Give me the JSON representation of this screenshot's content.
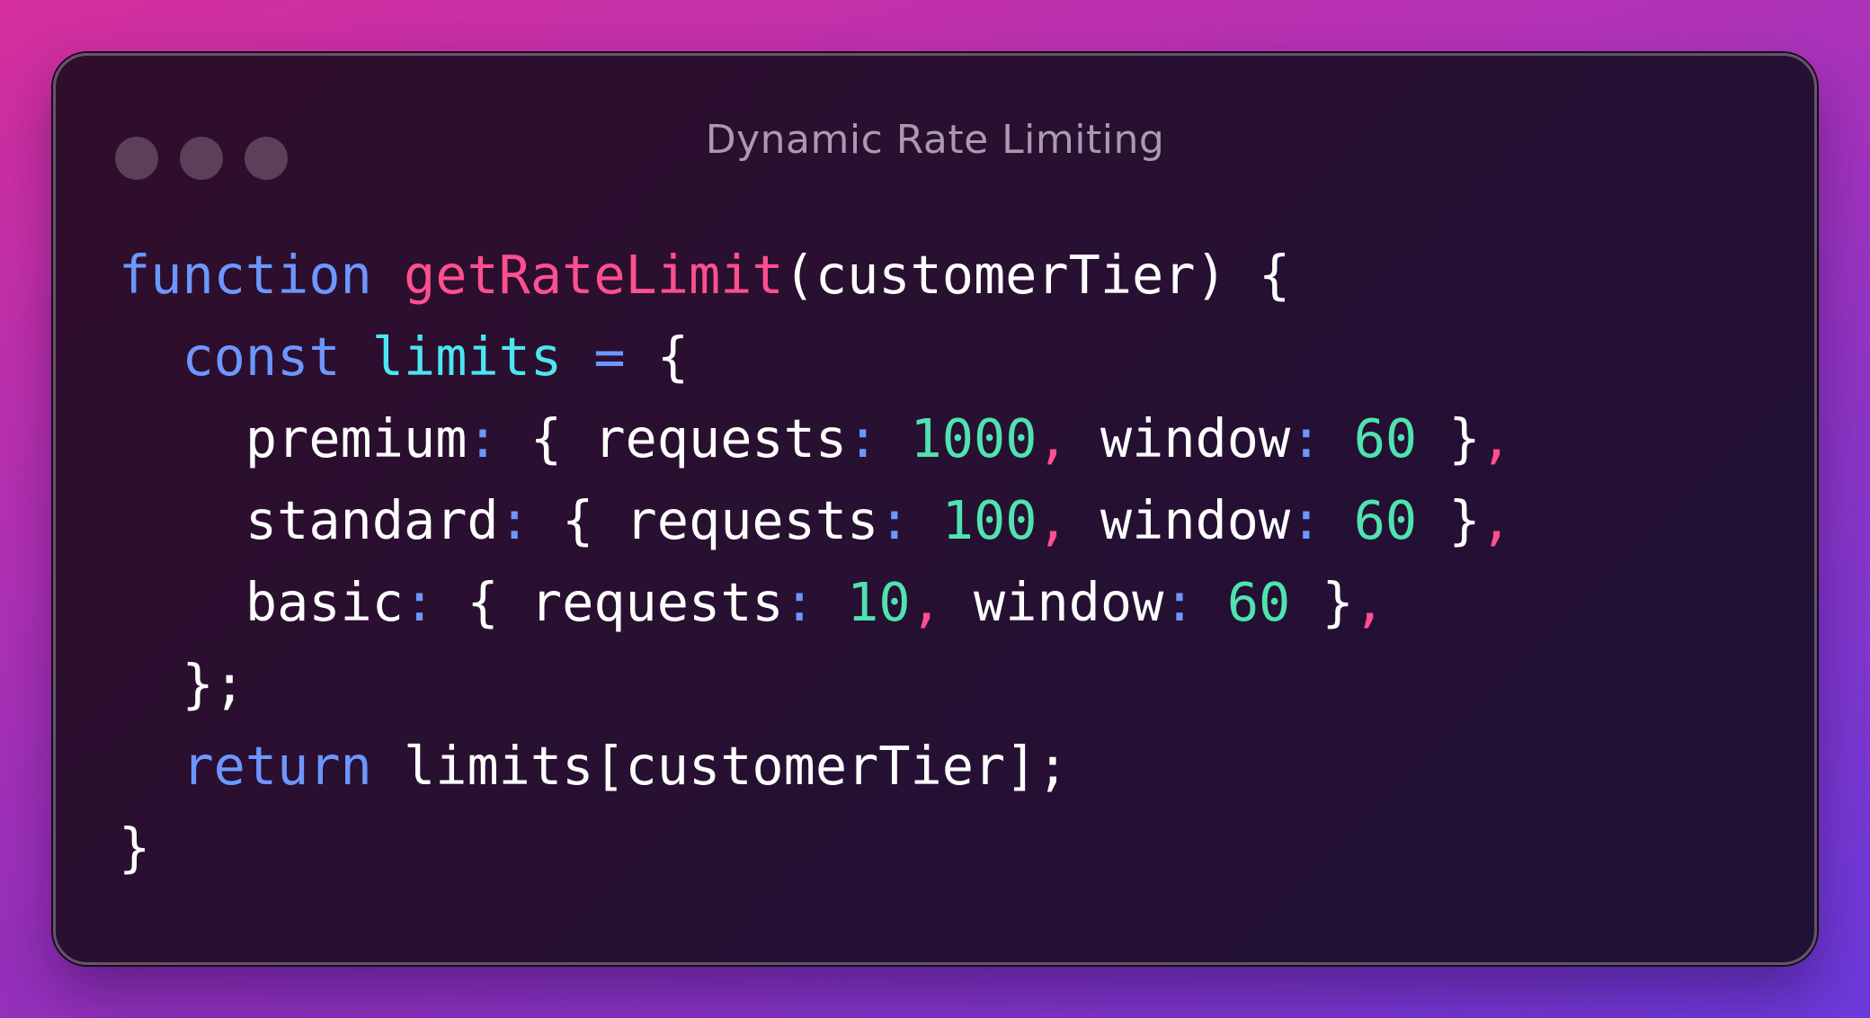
{
  "window": {
    "title": "Dynamic Rate Limiting",
    "controls": [
      "window-dot",
      "window-dot",
      "window-dot"
    ]
  },
  "colors": {
    "keyword": "#6c97ff",
    "function_name": "#ff4f8f",
    "variable": "#4ce6f0",
    "number": "#4fe3b0",
    "plain": "#ffffff",
    "title": "#a99bad"
  },
  "code": {
    "language": "javascript",
    "lines": [
      [
        {
          "t": "function",
          "c": "kw"
        },
        {
          "t": " ",
          "c": "plain"
        },
        {
          "t": "getRateLimit",
          "c": "fn"
        },
        {
          "t": "(customerTier) {",
          "c": "plain"
        }
      ],
      [
        {
          "t": "  ",
          "c": "plain"
        },
        {
          "t": "const",
          "c": "kw"
        },
        {
          "t": " ",
          "c": "plain"
        },
        {
          "t": "limits",
          "c": "var"
        },
        {
          "t": " ",
          "c": "plain"
        },
        {
          "t": "=",
          "c": "pun"
        },
        {
          "t": " {",
          "c": "plain"
        }
      ],
      [
        {
          "t": "    premium",
          "c": "plain"
        },
        {
          "t": ":",
          "c": "pun"
        },
        {
          "t": " { requests",
          "c": "plain"
        },
        {
          "t": ":",
          "c": "pun"
        },
        {
          "t": " ",
          "c": "plain"
        },
        {
          "t": "1000",
          "c": "num"
        },
        {
          "t": ",",
          "c": "cm"
        },
        {
          "t": " window",
          "c": "plain"
        },
        {
          "t": ":",
          "c": "pun"
        },
        {
          "t": " ",
          "c": "plain"
        },
        {
          "t": "60",
          "c": "num"
        },
        {
          "t": " }",
          "c": "plain"
        },
        {
          "t": ",",
          "c": "cm"
        }
      ],
      [
        {
          "t": "    standard",
          "c": "plain"
        },
        {
          "t": ":",
          "c": "pun"
        },
        {
          "t": " { requests",
          "c": "plain"
        },
        {
          "t": ":",
          "c": "pun"
        },
        {
          "t": " ",
          "c": "plain"
        },
        {
          "t": "100",
          "c": "num"
        },
        {
          "t": ",",
          "c": "cm"
        },
        {
          "t": " window",
          "c": "plain"
        },
        {
          "t": ":",
          "c": "pun"
        },
        {
          "t": " ",
          "c": "plain"
        },
        {
          "t": "60",
          "c": "num"
        },
        {
          "t": " }",
          "c": "plain"
        },
        {
          "t": ",",
          "c": "cm"
        }
      ],
      [
        {
          "t": "    basic",
          "c": "plain"
        },
        {
          "t": ":",
          "c": "pun"
        },
        {
          "t": " { requests",
          "c": "plain"
        },
        {
          "t": ":",
          "c": "pun"
        },
        {
          "t": " ",
          "c": "plain"
        },
        {
          "t": "10",
          "c": "num"
        },
        {
          "t": ",",
          "c": "cm"
        },
        {
          "t": " window",
          "c": "plain"
        },
        {
          "t": ":",
          "c": "pun"
        },
        {
          "t": " ",
          "c": "plain"
        },
        {
          "t": "60",
          "c": "num"
        },
        {
          "t": " }",
          "c": "plain"
        },
        {
          "t": ",",
          "c": "cm"
        }
      ],
      [
        {
          "t": "  };",
          "c": "plain"
        }
      ],
      [
        {
          "t": "  ",
          "c": "plain"
        },
        {
          "t": "return",
          "c": "kw"
        },
        {
          "t": " limits[customerTier];",
          "c": "plain"
        }
      ],
      [
        {
          "t": "}",
          "c": "plain"
        }
      ]
    ]
  }
}
